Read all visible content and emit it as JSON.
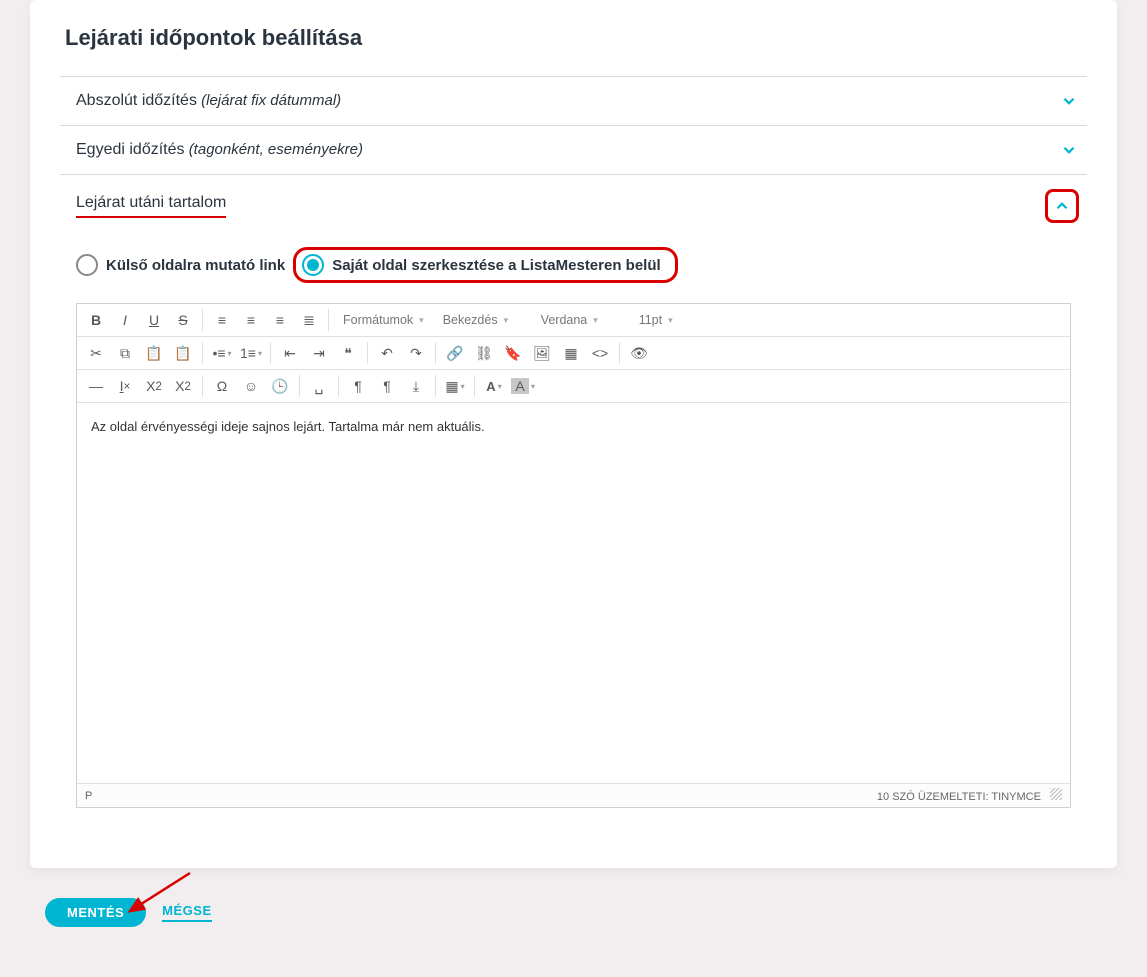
{
  "page_title": "Lejárati időpontok beállítása",
  "accordion": [
    {
      "label": "Abszolút időzítés",
      "note": "(lejárat fix dátummal)",
      "expanded": false
    },
    {
      "label": "Egyedi időzítés",
      "note": "(tagonként, eseményekre)",
      "expanded": false
    },
    {
      "label": "Lejárat utáni tartalom",
      "note": "",
      "expanded": true
    }
  ],
  "radios": {
    "external": "Külső oldalra mutató link",
    "owneditor": "Saját oldal szerkesztése a ListaMesteren belül"
  },
  "toolbar_selects": {
    "formats": "Formátumok",
    "paragraph": "Bekezdés",
    "fontfamily": "Verdana",
    "fontsize": "11pt"
  },
  "editor": {
    "content": "Az oldal érvényességi ideje sajnos lejárt. Tartalma már nem aktuális.",
    "path": "P",
    "status": "10 SZÓ ÜZEMELTETI: TINYMCE"
  },
  "buttons": {
    "save": "MENTÉS",
    "cancel": "MÉGSE"
  }
}
